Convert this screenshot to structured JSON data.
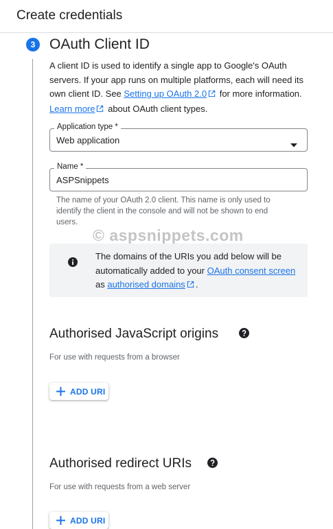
{
  "header": {
    "title": "Create credentials"
  },
  "step": {
    "number": "3",
    "title": "OAuth Client ID",
    "description": {
      "text1": "A client ID is used to identify a single app to Google's OAuth servers. If your app runs on multiple platforms, each will need its own client ID. See ",
      "link1": "Setting up OAuth 2.0",
      "text2": " for more information. ",
      "link2": "Learn more",
      "text3": " about OAuth client types."
    }
  },
  "application_type": {
    "label": "Application type *",
    "value": "Web application"
  },
  "name_field": {
    "label": "Name *",
    "value": "ASPSnippets",
    "hint": "The name of your OAuth 2.0 client. This name is only used to identify the client in the console and will not be shown to end users."
  },
  "watermark": "© aspsnippets.com",
  "info": {
    "text1": "The domains of the URIs you add below will be automatically added to your ",
    "link1": "OAuth consent screen",
    "text2": " as ",
    "link2": "authorised domains",
    "text3": "."
  },
  "js_origins": {
    "title": "Authorised JavaScript origins",
    "subtitle": "For use with requests from a browser",
    "button": "ADD URI"
  },
  "redirect_uris": {
    "title": "Authorised redirect URIs",
    "subtitle": "For use with requests from a web server",
    "button": "ADD URI"
  },
  "icons": {
    "external": "external-link-icon",
    "dropdown": "dropdown-arrow-icon",
    "info": "info-icon",
    "help": "help-icon",
    "plus": "plus-icon"
  },
  "colors": {
    "accent": "#1a73e8",
    "info_bg": "#f1f3f4",
    "text": "#202124",
    "muted": "#5f6368"
  }
}
